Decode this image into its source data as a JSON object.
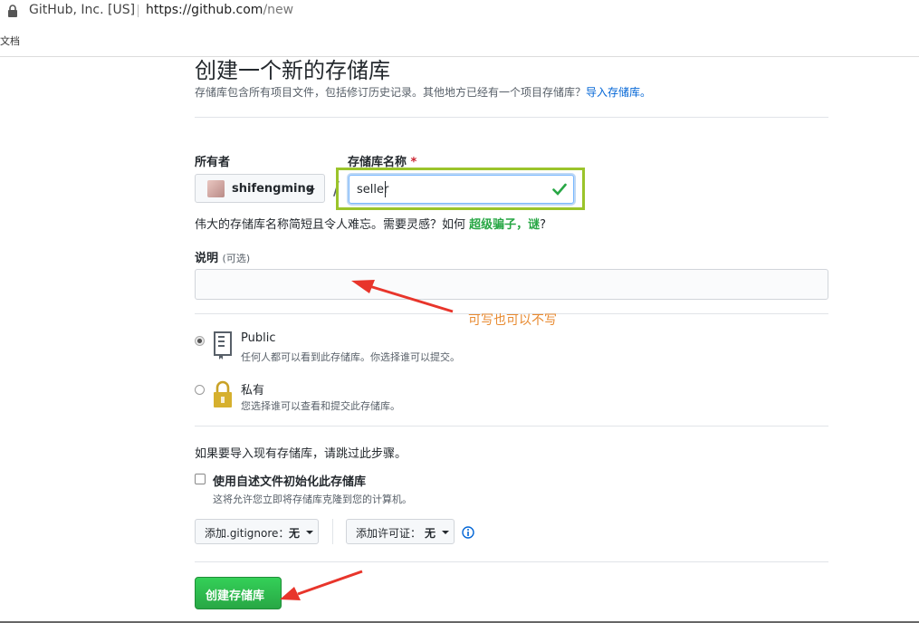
{
  "browser": {
    "site_identity": "GitHub, Inc. [US]",
    "url_host": "https://github.com",
    "url_path": "/new",
    "bookmark_label": "文档"
  },
  "page": {
    "title": "创建一个新的存储库",
    "subtitle": "存储库包含所有项目文件，包括修订历史记录。其他地方已经有一个项目存储库？",
    "import_link": "导入存储库。"
  },
  "owner": {
    "label": "所有者",
    "name": "shifengming"
  },
  "repo_name": {
    "label": "存储库名称",
    "required_mark": "*",
    "value": "seller",
    "slash": "/"
  },
  "name_hint": {
    "text": "伟大的存储库名称简短且令人难忘。需要灵感？如何 ",
    "suggestion": "超级骗子，谜",
    "suffix": "?"
  },
  "description": {
    "label": "说明",
    "optional": "(可选)"
  },
  "visibility": {
    "public_title": "Public",
    "public_desc": "任何人都可以看到此存储库。你选择谁可以提交。",
    "private_title": "私有",
    "private_desc": "您选择谁可以查看和提交此存储库。",
    "selected": "public"
  },
  "init": {
    "import_text": "如果要导入现有存储库，请跳过此步骤。",
    "checkbox_label": "使用自述文件初始化此存储库",
    "checkbox_desc": "这将允许您立即将存储库克隆到您的计算机。",
    "checked": false
  },
  "gitignore": {
    "label": "添加.gitignore：",
    "value": "无"
  },
  "license": {
    "label": "添加许可证：",
    "value": "无"
  },
  "create_button": "创建存储库",
  "annotation": "可写也可以不写",
  "colors": {
    "accent_green": "#28a745",
    "highlight_box": "#9bc42b",
    "annotation_arrow": "#e8352b",
    "annotation_text": "#e88a30",
    "link": "#0366d6"
  },
  "icons": [
    "lock-icon",
    "chevron-down-icon",
    "check-icon",
    "book-icon",
    "lock-icon",
    "info-icon",
    "arrow-annotation"
  ]
}
